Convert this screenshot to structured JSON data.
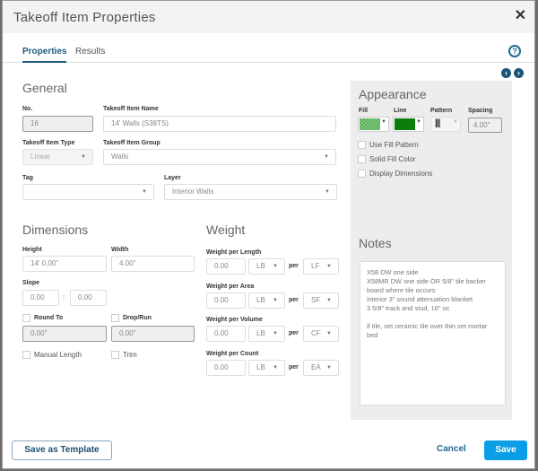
{
  "window": {
    "title": "Takeoff Item Properties"
  },
  "tabs": [
    {
      "label": "Properties",
      "active": true
    },
    {
      "label": "Results",
      "active": false
    }
  ],
  "icons": {
    "close": "close-icon",
    "help": "?",
    "prev": "‹",
    "next": "›"
  },
  "general": {
    "title": "General",
    "no_label": "No.",
    "no_value": "16",
    "name_label": "Takeoff Item Name",
    "name_value": "14' Walls (S38TS)",
    "type_label": "Takeoff Item Type",
    "type_value": "Linear",
    "group_label": "Takeoff Item Group",
    "group_value": "Walls",
    "tag_label": "Tag",
    "tag_value": "",
    "layer_label": "Layer",
    "layer_value": "Interior Walls"
  },
  "dimensions": {
    "title": "Dimensions",
    "height_label": "Height",
    "height_value": "14' 0.00\"",
    "width_label": "Width",
    "width_value": "4.00\"",
    "slope_label": "Slope",
    "slope_rise": "0.00",
    "slope_sep": ":",
    "slope_run": "0.00",
    "round_to_label": "Round To",
    "round_to_value": "0.00\"",
    "drop_run_label": "Drop/Run",
    "drop_run_value": "0.00\"",
    "manual_length_label": "Manual Length",
    "trim_label": "Trim"
  },
  "weight": {
    "title": "Weight",
    "per_label": "per",
    "rows": [
      {
        "label": "Weight per Length",
        "value": "0.00",
        "unit": "LB",
        "per_unit": "LF"
      },
      {
        "label": "Weight per Area",
        "value": "0.00",
        "unit": "LB",
        "per_unit": "SF"
      },
      {
        "label": "Weight per Volume",
        "value": "0.00",
        "unit": "LB",
        "per_unit": "CF"
      },
      {
        "label": "Weight per Count",
        "value": "0.00",
        "unit": "LB",
        "per_unit": "EA"
      }
    ]
  },
  "appearance": {
    "title": "Appearance",
    "fill_label": "Fill",
    "fill_color": "#5fb35f",
    "line_label": "Line",
    "line_color": "#0b7d0b",
    "pattern_label": "Pattern",
    "pattern_value": "|||",
    "spacing_label": "Spacing",
    "spacing_value": "4.00\"",
    "use_fill_pattern_label": "Use Fill Pattern",
    "solid_fill_color_label": "Solid Fill Color",
    "display_dimensions_label": "Display Dimensions"
  },
  "notes": {
    "title": "Notes",
    "text": "X58 DW one side\nX58MR DW one side OR 5/8\" tile backer board where tile occurs\ninterior 3\" sound attenuation blanket\n3 5/8\" track and stud, 16\" oc\n\nif tile, set ceramic tile over thin set mortar bed"
  },
  "footer": {
    "save_template_label": "Save as Template",
    "cancel_label": "Cancel",
    "save_label": "Save"
  }
}
